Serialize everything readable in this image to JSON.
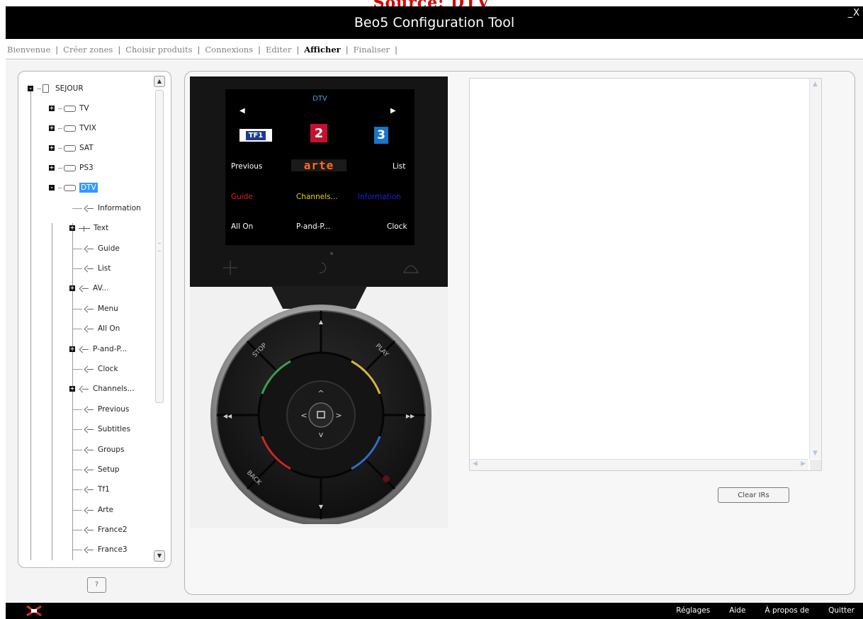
{
  "caption": "Source: DTV",
  "window": {
    "title": "Beo5 Configuration Tool",
    "minimize": "_",
    "close": "X"
  },
  "nav": {
    "items": [
      {
        "label": "Bienvenue"
      },
      {
        "label": "Créer zones"
      },
      {
        "label": "Choisir produits"
      },
      {
        "label": "Connexions"
      },
      {
        "label": "Editer"
      },
      {
        "label": "Afficher",
        "active": true
      },
      {
        "label": "Finaliser"
      }
    ],
    "separator": "|"
  },
  "tree": {
    "room": "SEJOUR",
    "sources": [
      "TV",
      "TVIX",
      "SAT",
      "PS3",
      "DTV"
    ],
    "selected_source": "DTV",
    "expand_symbol": "+",
    "collapse_symbol": "-",
    "buttons": [
      "Information",
      "Text",
      "Guide",
      "List",
      "AV...",
      "Menu",
      "All On",
      "P-and-P...",
      "Clock",
      "Channels...",
      "Previous",
      "Subtitles",
      "Groups",
      "Setup",
      "Tf1",
      "Arte",
      "France2",
      "France3"
    ]
  },
  "help_button": "?",
  "remote": {
    "screen_title": "DTV",
    "logos": {
      "tf1": "TF1",
      "france2": "2",
      "france3": "3",
      "arte": "arte"
    },
    "labels": {
      "previous": "Previous",
      "list": "List",
      "guide": "Guide",
      "channels": "Channels...",
      "information": "Information",
      "all_on": "All On",
      "p_and_p": "P-and-P...",
      "clock": "Clock"
    },
    "wheel": {
      "stop": "STOP",
      "play": "PLAY",
      "back": "BACK"
    },
    "colors": {
      "green": "#3aa14a",
      "yellow": "#d9b640",
      "red": "#c9272d",
      "blue": "#2f6fc5",
      "screen_blue": "#33a8e6",
      "guide_red": "#e02020",
      "channels_yellow": "#e8d800",
      "information_blue": "#1a22e0"
    }
  },
  "clear_irs_button": "Clear IRs",
  "footer": {
    "items": [
      "Réglages",
      "Aide",
      "À propos de",
      "Quitter"
    ]
  }
}
